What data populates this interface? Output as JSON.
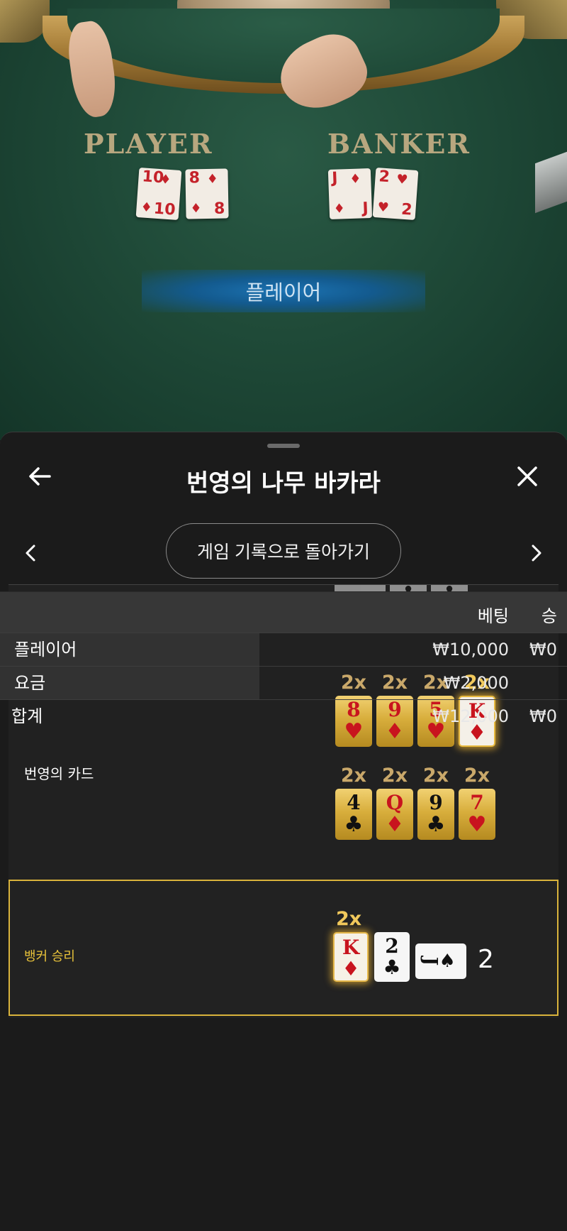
{
  "video": {
    "player_label": "PLAYER",
    "banker_label": "BANKER",
    "player_cards": [
      {
        "rank": "10",
        "suit": "♦"
      },
      {
        "rank": "8",
        "suit": "♦"
      }
    ],
    "banker_cards": [
      {
        "rank": "J",
        "suit": "♦"
      },
      {
        "rank": "2",
        "suit": "♥"
      }
    ],
    "result_text": "플레이어"
  },
  "sheet": {
    "title": "번영의 나무 바카라",
    "back_to_history": "게임 기록으로 돌아가기"
  },
  "fortune": {
    "label": "번영의 카드",
    "row1": [
      {
        "mult": "2x",
        "rank": "8",
        "suit": "♥",
        "color": "red",
        "win": false
      },
      {
        "mult": "2x",
        "rank": "9",
        "suit": "♦",
        "color": "red",
        "win": false
      },
      {
        "mult": "2x",
        "rank": "5",
        "suit": "♥",
        "color": "red",
        "win": false
      },
      {
        "mult": "2x",
        "rank": "K",
        "suit": "♦",
        "color": "red",
        "win": true
      }
    ],
    "row2": [
      {
        "mult": "2x",
        "rank": "4",
        "suit": "♣",
        "color": "black",
        "win": false
      },
      {
        "mult": "2x",
        "rank": "Q",
        "suit": "♦",
        "color": "red",
        "win": false
      },
      {
        "mult": "2x",
        "rank": "9",
        "suit": "♣",
        "color": "black",
        "win": false
      },
      {
        "mult": "2x",
        "rank": "7",
        "suit": "♥",
        "color": "red",
        "win": false
      }
    ]
  },
  "banker_win": {
    "label": "뱅커 승리",
    "mult": "2x",
    "cards": [
      {
        "rank": "K",
        "suit": "♦"
      },
      {
        "rank": "2",
        "suit": "♣"
      },
      {
        "rank": "J",
        "suit": "♠"
      }
    ],
    "score": "2"
  },
  "bets": {
    "col_bet": "베팅",
    "col_win": "승",
    "rows": [
      {
        "label": "플레이어",
        "bet": "₩10,000",
        "win": "₩0"
      },
      {
        "label": "요금",
        "bet": "₩2,000",
        "win": ""
      }
    ],
    "total": {
      "label": "합계",
      "bet": "₩12,000",
      "win": "₩0"
    }
  },
  "colors": {
    "felt": "#1f4a38",
    "gold": "#d9b33c",
    "banner_blue": "#1c73b3",
    "sheet_bg": "#1b1b1b"
  }
}
